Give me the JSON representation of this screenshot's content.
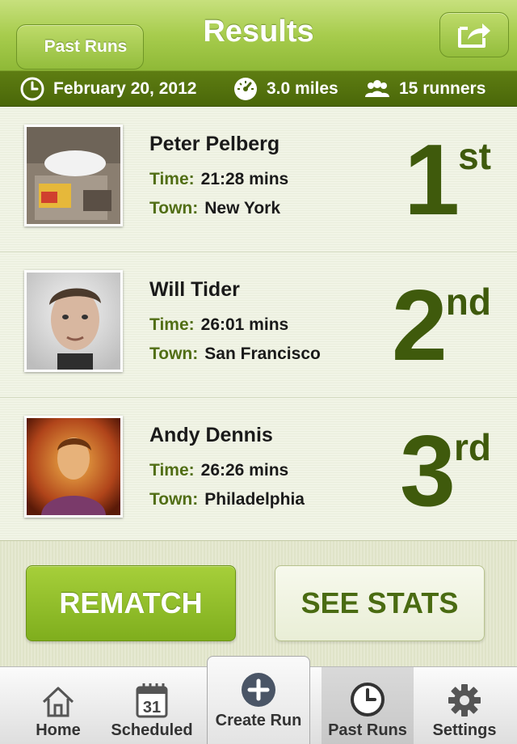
{
  "nav": {
    "back_label": "Past Runs",
    "title": "Results",
    "share_icon": "share-icon"
  },
  "info": {
    "date": "February 20, 2012",
    "distance": "3.0 miles",
    "runners": "15 runners"
  },
  "labels": {
    "time": "Time:",
    "town": "Town:"
  },
  "results": [
    {
      "name": "Peter Pelberg",
      "time": "21:28 mins",
      "town": "New York",
      "place_num": "1",
      "place_suffix": "st"
    },
    {
      "name": "Will Tider",
      "time": "26:01 mins",
      "town": "San Francisco",
      "place_num": "2",
      "place_suffix": "nd"
    },
    {
      "name": "Andy Dennis",
      "time": "26:26 mins",
      "town": "Philadelphia",
      "place_num": "3",
      "place_suffix": "rd"
    }
  ],
  "actions": {
    "rematch": "REMATCH",
    "stats": "SEE STATS"
  },
  "tabs": [
    {
      "label": "Home",
      "icon": "home-icon"
    },
    {
      "label": "Scheduled",
      "icon": "calendar-icon",
      "icon_text": "31"
    },
    {
      "label": "Create Run",
      "icon": "plus-circle-icon"
    },
    {
      "label": "Past Runs",
      "icon": "clock-icon"
    },
    {
      "label": "Settings",
      "icon": "gear-icon"
    }
  ],
  "colors": {
    "nav_green": "#a7cc4d",
    "info_bar": "#4a6709",
    "place_green": "#3f5a0c",
    "label_green": "#516e15",
    "rematch_green": "#8fbe2a"
  }
}
